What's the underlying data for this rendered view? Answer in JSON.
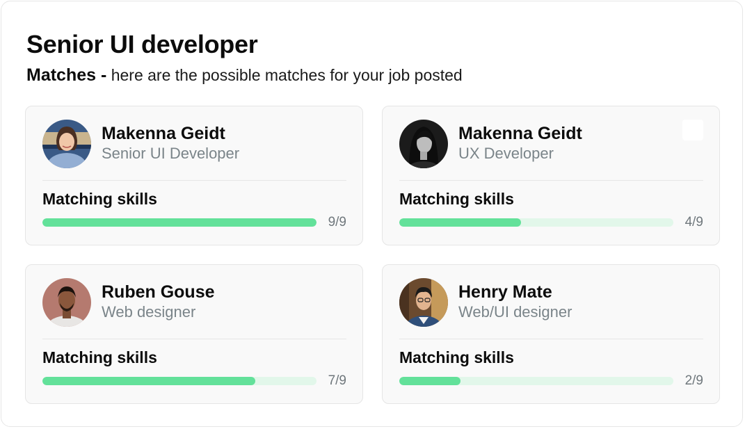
{
  "header": {
    "title": "Senior UI developer",
    "subtitle_strong": "Matches -",
    "subtitle_text": " here are the possible matches for your job posted"
  },
  "colors": {
    "progress_fill": "#63e19a",
    "progress_track": "#e2f7ea",
    "role_text": "#7a8489"
  },
  "matches": [
    {
      "name": "Makenna Geidt",
      "role": "Senior UI Developer",
      "avatar": "avatar-woman-smiling",
      "skills_label": "Matching skills",
      "matched": 9,
      "total": 9,
      "count_text": "9/9",
      "checkbox": false
    },
    {
      "name": "Makenna Geidt",
      "role": "UX Developer",
      "avatar": "avatar-woman-monochrome",
      "skills_label": "Matching skills",
      "matched": 4,
      "total": 9,
      "count_text": "4/9",
      "checkbox": true
    },
    {
      "name": "Ruben Gouse",
      "role": "Web designer",
      "avatar": "avatar-man-beard",
      "skills_label": "Matching skills",
      "matched": 7,
      "total": 9,
      "count_text": "7/9",
      "checkbox": false
    },
    {
      "name": "Henry Mate",
      "role": "Web/UI designer",
      "avatar": "avatar-man-glasses",
      "skills_label": "Matching skills",
      "matched": 2,
      "total": 9,
      "count_text": "2/9",
      "checkbox": false
    }
  ]
}
